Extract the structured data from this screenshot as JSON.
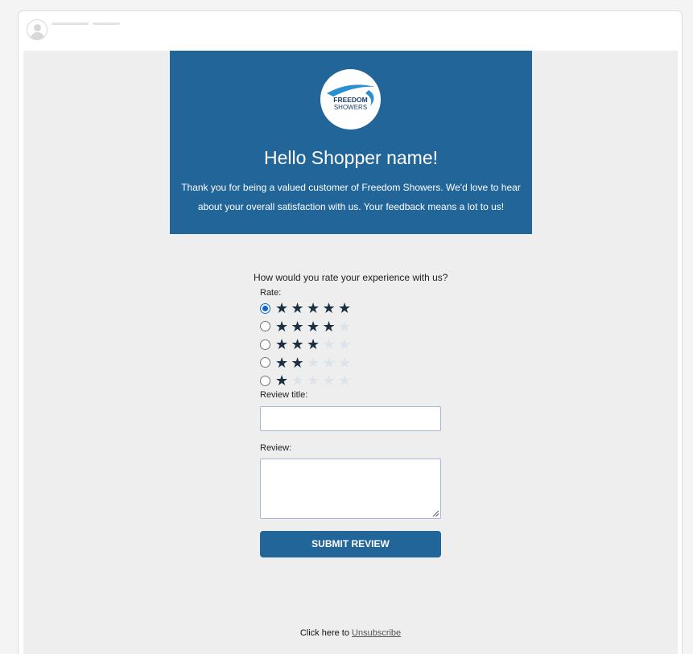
{
  "colors": {
    "brand_blue": "#216599",
    "star_filled": "#1b2f40",
    "star_empty": "#dde3e8",
    "radio_selected": "#0a64d6"
  },
  "header": {
    "avatar_icon": "user-avatar-icon"
  },
  "email": {
    "logo": {
      "line1": "FREEDOM",
      "line2": "SHOWERS"
    },
    "greeting": "Hello Shopper name!",
    "intro": "Thank you for being a valued customer of Freedom Showers. We'd love to hear about your overall satisfaction with us. Your feedback means a lot to us!"
  },
  "form": {
    "question": "How would you rate your experience with us?",
    "rate_label": "Rate:",
    "star_icon": "star-icon",
    "ratings": [
      {
        "stars": 5,
        "selected": true
      },
      {
        "stars": 4,
        "selected": false
      },
      {
        "stars": 3,
        "selected": false
      },
      {
        "stars": 2,
        "selected": false
      },
      {
        "stars": 1,
        "selected": false
      }
    ],
    "max_stars": 5,
    "review_title_label": "Review title:",
    "review_title_value": "",
    "review_label": "Review:",
    "review_value": "",
    "submit_label": "SUBMIT REVIEW"
  },
  "footer": {
    "prefix": "Click here to",
    "link": "Unsubscribe"
  }
}
